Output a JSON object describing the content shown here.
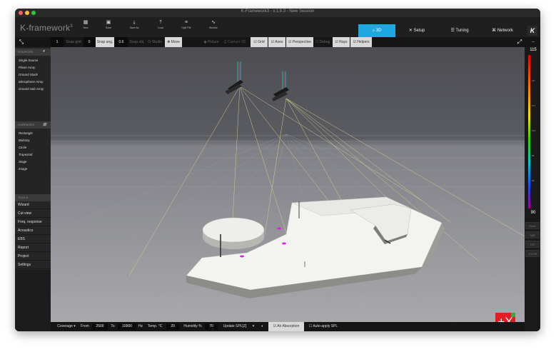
{
  "window": {
    "title": "K-Framework3 - v.1.8.3 - New Session"
  },
  "brand": {
    "name": "K-framework",
    "sup": "3"
  },
  "toolbar_top": {
    "buttons": [
      {
        "label": "New",
        "icon": "new-file-icon",
        "glyph": "▦"
      },
      {
        "label": "Save",
        "icon": "save-icon",
        "glyph": "▣"
      },
      {
        "label": "Save As",
        "icon": "save-as-icon",
        "glyph": "⤓"
      },
      {
        "label": "Load",
        "icon": "load-icon",
        "glyph": "⤒"
      },
      {
        "label": "Split FW",
        "icon": "split-icon",
        "glyph": "≡"
      },
      {
        "label": "Monitor",
        "icon": "monitor-icon",
        "glyph": "∿"
      }
    ],
    "tabs": [
      {
        "label": "⌂ 3D",
        "active": true
      },
      {
        "label": "✕ Setup",
        "active": false
      },
      {
        "label": "☰ Tuning",
        "active": false
      },
      {
        "label": "⌘ Network",
        "active": false
      }
    ],
    "k_logo": "K"
  },
  "toolbar": {
    "snap_grid_val": "1",
    "snap_grid_label": "Snap grid",
    "snap_grid_val2": "0",
    "snap_ang_label": "Snap ang.",
    "snap_ang_val": "0.6",
    "snap_obj_label": "Snap obj.",
    "studio": "☊ Studio",
    "move": "✥ Move",
    "blank1": "",
    "picture": "◉ Picture",
    "capture": "⎙ Capture 3D",
    "grid": "☑ Grid",
    "axes": "☑ Axes",
    "perspective": "☑ Perspective",
    "debug": "☐ Debug",
    "rays": "☑ Rays",
    "helpers": "☑ Helpers"
  },
  "sidebar": {
    "sources_header": "SOURCES",
    "sources": [
      "Single Source",
      "Flown Array",
      "Ground Stack",
      "Microphone Array",
      "Ground Sub Array"
    ],
    "surfaces_header": "SURFACES",
    "surfaces": [
      "Rectangle",
      "Balcony",
      "Circle",
      "Trapezoid",
      "Stage",
      "Image"
    ],
    "tools_header": "TOOLS",
    "tools": [
      "Wizard",
      "Cut view",
      "Freq. response",
      "Acoustics",
      "EBS",
      "Report",
      "Project",
      "Settings"
    ]
  },
  "scale": {
    "top": "115",
    "bottom": "90",
    "ticks": [
      "111",
      "107",
      "103",
      "99",
      "95"
    ]
  },
  "rightbar_buttons": [
    "Reset",
    "SAB",
    "TOP",
    "COLOR"
  ],
  "bottombar": {
    "coverage": "Coverage ▾",
    "from_label": "From",
    "from_val": "2500",
    "to_label": "To",
    "to_val": "10000",
    "hz": "Hz",
    "temp_label": "Temp. °C",
    "temp_val": "20",
    "humidity_label": "Humidity %",
    "humidity_val": "70",
    "update_label": "Update SPL[Z]",
    "air_absorption": "☑ Air Absorption",
    "auto_apply": "☐ Auto-apply SPL"
  },
  "colors": {
    "accent": "#1ea8e0",
    "marker": "#e020e0",
    "logo_red": "#e31d25",
    "logo_green": "#3aa935"
  }
}
